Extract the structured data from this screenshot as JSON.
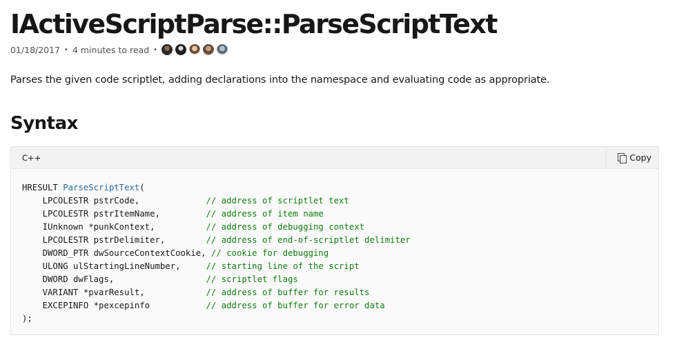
{
  "page": {
    "title": "IActiveScriptParse::ParseScriptText",
    "date": "01/18/2017",
    "read_time": "4 minutes to read",
    "separator": "•",
    "contributors": [
      {
        "name": "contributor-avatar-1"
      },
      {
        "name": "contributor-avatar-2"
      },
      {
        "name": "contributor-avatar-3"
      },
      {
        "name": "contributor-avatar-4"
      },
      {
        "name": "contributor-avatar-5"
      }
    ],
    "summary": "Parses the given code scriptlet, adding declarations into the namespace and evaluating code as appropriate.",
    "syntax_heading": "Syntax"
  },
  "code_block": {
    "language": "C++",
    "copy_label": "Copy",
    "copy_icon": "copy-icon",
    "first_line": {
      "prefix": "HRESULT ",
      "function": "ParseScriptText",
      "suffix": "("
    },
    "params": [
      {
        "decl": "    LPCOLESTR pstrCode,             ",
        "comment": "// address of scriptlet text"
      },
      {
        "decl": "    LPCOLESTR pstrItemName,         ",
        "comment": "// address of item name"
      },
      {
        "decl": "    IUnknown *punkContext,          ",
        "comment": "// address of debugging context"
      },
      {
        "decl": "    LPCOLESTR pstrDelimiter,        ",
        "comment": "// address of end-of-scriptlet delimiter"
      },
      {
        "decl": "    DWORD_PTR dwSourceContextCookie,",
        "comment": " // cookie for debugging"
      },
      {
        "decl": "    ULONG ulStartingLineNumber,     ",
        "comment": "// starting line of the script"
      },
      {
        "decl": "    DWORD dwFlags,                  ",
        "comment": "// scriptlet flags"
      },
      {
        "decl": "    VARIANT *pvarResult,            ",
        "comment": "// address of buffer for results"
      },
      {
        "decl": "    EXCEPINFO *pexcepinfo           ",
        "comment": "// address of buffer for error data"
      }
    ],
    "closing": ");",
    "colors": {
      "function": "#2b6b9e",
      "comment": "#127c12",
      "background": "#fafafa",
      "header_background": "#f2f2f2"
    }
  }
}
